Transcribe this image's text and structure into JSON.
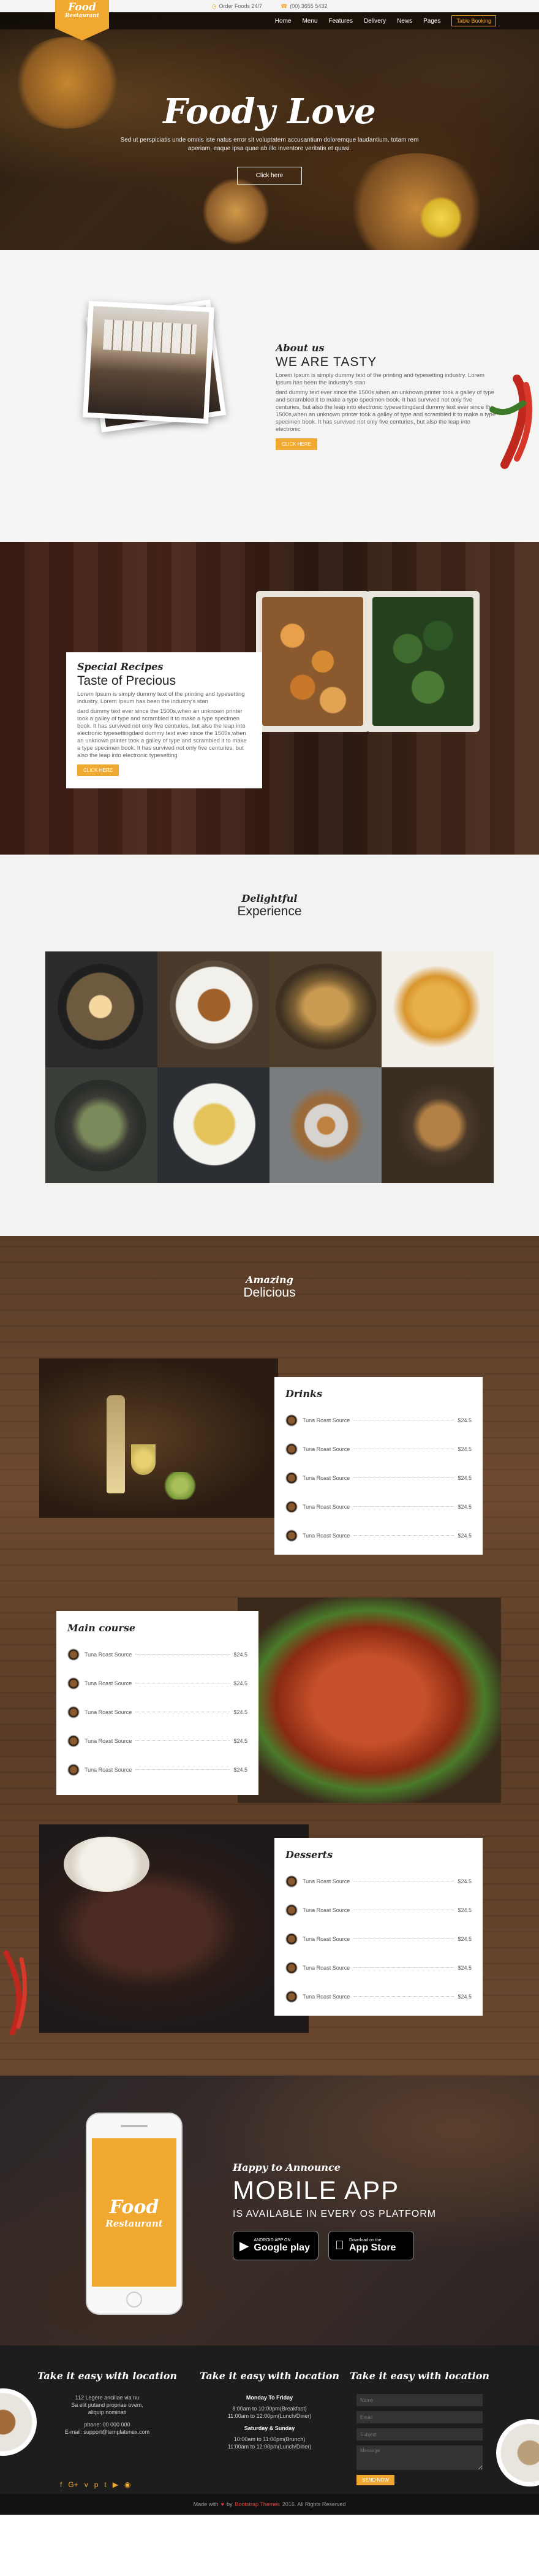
{
  "topbar": {
    "order": "Order Foods 24/7",
    "phone": "(00) 3655 5432"
  },
  "logo": {
    "line1": "Food",
    "line2": "Restaurant"
  },
  "nav": {
    "items": [
      "Home",
      "Menu",
      "Features",
      "Delivery",
      "News",
      "Pages"
    ],
    "book": "Table Booking"
  },
  "hero": {
    "title": "Foody Love",
    "text": "Sed ut perspiciatis unde omnis iste natus error sit voluptatem accusantium doloremque laudantium, totam rem aperiam, eaque ipsa quae ab illo inventore veritatis et quasi.",
    "button": "Click here"
  },
  "about": {
    "script": "About us",
    "title": "WE ARE TASTY",
    "p1": "Lorem Ipsum is simply dummy text of the printing and typesetting industry. Lorem Ipsum has been the industry's stan",
    "p2": "dard dummy text ever since the 1500s,when an unknown printer took a galley of type and scrambled it to make a type specimen book. It has survived not only five centuries, but also the leap into electronic typesettingdard dummy text ever since the 1500s,when an unknown printer took a galley of type and scrambled it to make a type specimen book. It has survived not only five centuries, but also the leap into electronic",
    "button": "CLICK HERE"
  },
  "special": {
    "script": "Special Recipes",
    "title": "Taste of Precious",
    "p1": "Lorem Ipsum is simply dummy text of the printing and typesetting industry. Lorem Ipsum has been the industry's stan",
    "p2": "dard dummy text ever since the 1500s,when an unknown printer took a galley of type and scrambled it to make a type specimen book. It has survived not only five centuries, but also the leap into electronic typesettingdard dummy text ever since the 1500s,when an unknown printer took a galley of type and scrambled it to make a type specimen book. It has survived not only five centuries, but also the leap into electronic typesetting",
    "button": "CLICK HERE"
  },
  "delight": {
    "script": "Delightful",
    "title": "Experience"
  },
  "menu": {
    "script": "Amazing",
    "title": "Delicious",
    "drinks": {
      "title": "Drinks",
      "items": [
        {
          "name": "Tuna Roast Source",
          "price": "$24.5"
        },
        {
          "name": "Tuna Roast Source",
          "price": "$24.5"
        },
        {
          "name": "Tuna Roast Source",
          "price": "$24.5"
        },
        {
          "name": "Tuna Roast Source",
          "price": "$24.5"
        },
        {
          "name": "Tuna Roast Source",
          "price": "$24.5"
        }
      ]
    },
    "main": {
      "title": "Main course",
      "items": [
        {
          "name": "Tuna Roast Source",
          "price": "$24.5"
        },
        {
          "name": "Tuna Roast Source",
          "price": "$24.5"
        },
        {
          "name": "Tuna Roast Source",
          "price": "$24.5"
        },
        {
          "name": "Tuna Roast Source",
          "price": "$24.5"
        },
        {
          "name": "Tuna Roast Source",
          "price": "$24.5"
        }
      ]
    },
    "desserts": {
      "title": "Desserts",
      "items": [
        {
          "name": "Tuna Roast Source",
          "price": "$24.5"
        },
        {
          "name": "Tuna Roast Source",
          "price": "$24.5"
        },
        {
          "name": "Tuna Roast Source",
          "price": "$24.5"
        },
        {
          "name": "Tuna Roast Source",
          "price": "$24.5"
        },
        {
          "name": "Tuna Roast Source",
          "price": "$24.5"
        }
      ]
    }
  },
  "app": {
    "script": "Happy to Announce",
    "title": "MOBILE APP",
    "sub": "IS AVAILABLE IN EVERY OS PLATFORM",
    "google_small": "ANDROID APP ON",
    "google_big": "Google play",
    "apple_small": "Download on the",
    "apple_big": "App Store",
    "phone_l1": "Food",
    "phone_l2": "Restaurant"
  },
  "footer": {
    "col1": {
      "title": "Take it easy with location",
      "lines": [
        "112 Legere ancillae via nu",
        "Sa elit putand propriae ovem,",
        "aliquip nominati",
        "",
        "phone: 00 000 000",
        "E-mail: support@templatenex.com"
      ]
    },
    "col2": {
      "title": "Take it easy with location",
      "days1": "Monday To Friday",
      "h1": "8:00am to 10:00pm(Breakfast)",
      "h2": "11:00am to 12:00pm(Lunch/Diner)",
      "days2": "Saturday & Sunday",
      "h3": "10:00am to 11:00pm(Brunch)",
      "h4": "11:00am to 12:00pm(Lunch/Diner)"
    },
    "col3": {
      "title": "Take it easy with location",
      "name": "Name",
      "email": "Email",
      "subject": "Subject",
      "message": "Message",
      "send": "SEND NOW"
    },
    "copyright": {
      "pre": "Made with",
      "by": "by",
      "brand": "Bootstrap Themes",
      "post": "2016. All Rights Reserved"
    }
  },
  "colors": {
    "accent": "#f0a830",
    "dark": "#1d1d1d"
  }
}
